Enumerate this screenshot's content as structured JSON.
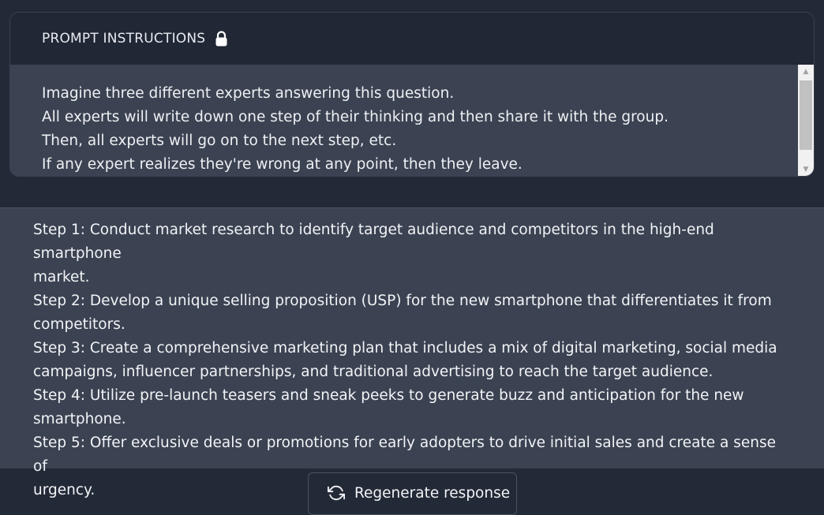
{
  "prompt": {
    "title": "PROMPT INSTRUCTIONS",
    "lock_icon": "lock-icon",
    "lines": [
      "Imagine three different experts answering this question.",
      "All experts will write down one step of their thinking and then share it with the group.",
      "Then, all experts will go on to the next step, etc.",
      "If any expert realizes they're wrong at any point, then they leave."
    ]
  },
  "response": {
    "lines": [
      "Step 1: Conduct market research to identify target audience and competitors in the high-end smartphone",
      "market.",
      "Step 2: Develop a unique selling proposition (USP) for the new smartphone that differentiates it from",
      "competitors.",
      "Step 3: Create a comprehensive marketing plan that includes a mix of digital marketing, social media",
      "campaigns, influencer partnerships, and traditional advertising to reach the target audience.",
      "Step 4: Utilize pre-launch teasers and sneak peeks to generate buzz and anticipation for the new",
      "smartphone.",
      "Step 5: Offer exclusive deals or promotions for early adopters to drive initial sales and create a sense of",
      "urgency."
    ]
  },
  "actions": {
    "regenerate_label": "Regenerate response",
    "regenerate_icon": "refresh-icon"
  },
  "colors": {
    "page_background": "#232a37",
    "panel_background": "#3b4352",
    "header_background": "#202735",
    "text": "#eef0f3"
  }
}
